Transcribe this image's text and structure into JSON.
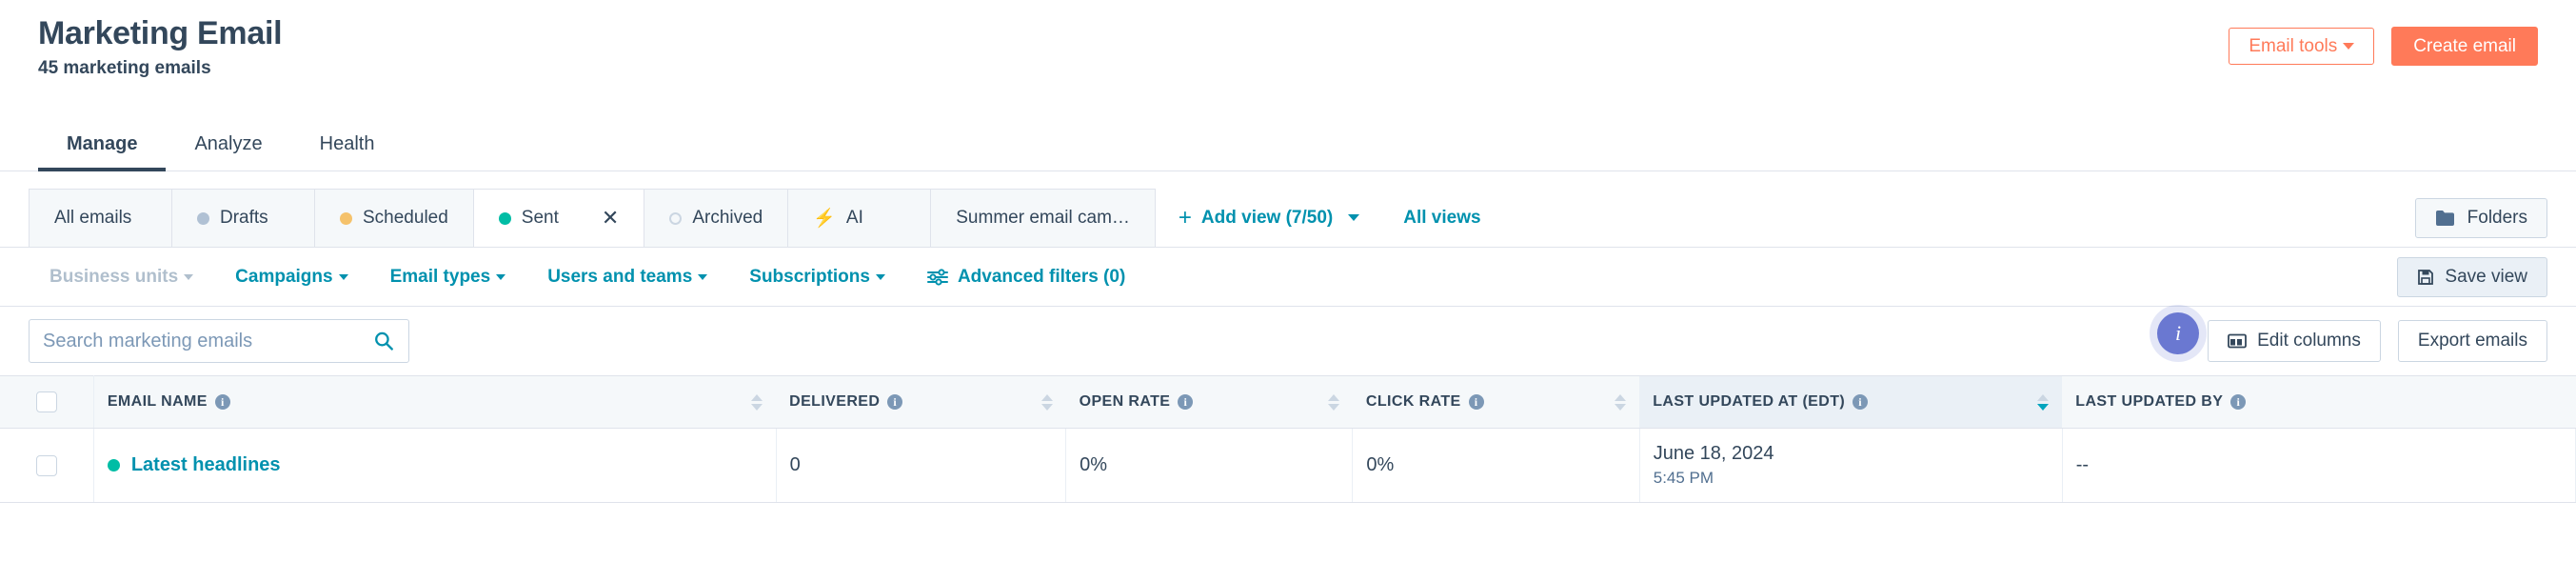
{
  "header": {
    "title": "Marketing Email",
    "subtitle": "45 marketing emails",
    "email_tools_label": "Email tools",
    "create_email_label": "Create email"
  },
  "main_tabs": [
    {
      "label": "Manage",
      "active": true
    },
    {
      "label": "Analyze",
      "active": false
    },
    {
      "label": "Health",
      "active": false
    }
  ],
  "view_tabs": [
    {
      "label": "All emails",
      "dot": "none",
      "active": false
    },
    {
      "label": "Drafts",
      "dot": "#b0c1d4",
      "active": false
    },
    {
      "label": "Scheduled",
      "dot": "#f5c26b",
      "active": false
    },
    {
      "label": "Sent",
      "dot": "#00bda5",
      "active": true,
      "closable": true
    },
    {
      "label": "Archived",
      "dot": "hollow",
      "active": false
    },
    {
      "label": "AI",
      "dot": "ai",
      "active": false
    },
    {
      "label": "Summer email cam…",
      "dot": "none",
      "active": false
    }
  ],
  "view_actions": {
    "add_view_label": "Add view (7/50)",
    "all_views_label": "All views",
    "folders_label": "Folders"
  },
  "filters": {
    "items": [
      {
        "label": "Business units",
        "disabled": true
      },
      {
        "label": "Campaigns",
        "disabled": false
      },
      {
        "label": "Email types",
        "disabled": false
      },
      {
        "label": "Users and teams",
        "disabled": false
      },
      {
        "label": "Subscriptions",
        "disabled": false
      }
    ],
    "advanced_label": "Advanced filters (0)",
    "save_view_label": "Save view"
  },
  "toolbar": {
    "search_placeholder": "Search marketing emails",
    "search_value": "",
    "info_badge": "i",
    "edit_columns_label": "Edit columns",
    "export_emails_label": "Export emails"
  },
  "table": {
    "columns": [
      {
        "label": "EMAIL NAME",
        "info": true,
        "sortable": true,
        "sorted": false
      },
      {
        "label": "DELIVERED",
        "info": true,
        "sortable": true,
        "sorted": false
      },
      {
        "label": "OPEN RATE",
        "info": true,
        "sortable": true,
        "sorted": false
      },
      {
        "label": "CLICK RATE",
        "info": true,
        "sortable": true,
        "sorted": false
      },
      {
        "label": "LAST UPDATED AT (EDT)",
        "info": true,
        "sortable": true,
        "sorted": true
      },
      {
        "label": "LAST UPDATED BY",
        "info": true,
        "sortable": false,
        "sorted": false
      }
    ],
    "rows": [
      {
        "status_color": "#00bda5",
        "name": "Latest headlines",
        "delivered": "0",
        "open_rate": "0%",
        "click_rate": "0%",
        "last_updated_date": "June 18, 2024",
        "last_updated_time": "5:45 PM",
        "last_updated_by": "--"
      }
    ]
  },
  "colors": {
    "brand_orange": "#ff7a59",
    "link_teal": "#0091ae",
    "text_navy": "#33475b",
    "badge_purple": "#6a78d1",
    "sent_green": "#00bda5"
  }
}
